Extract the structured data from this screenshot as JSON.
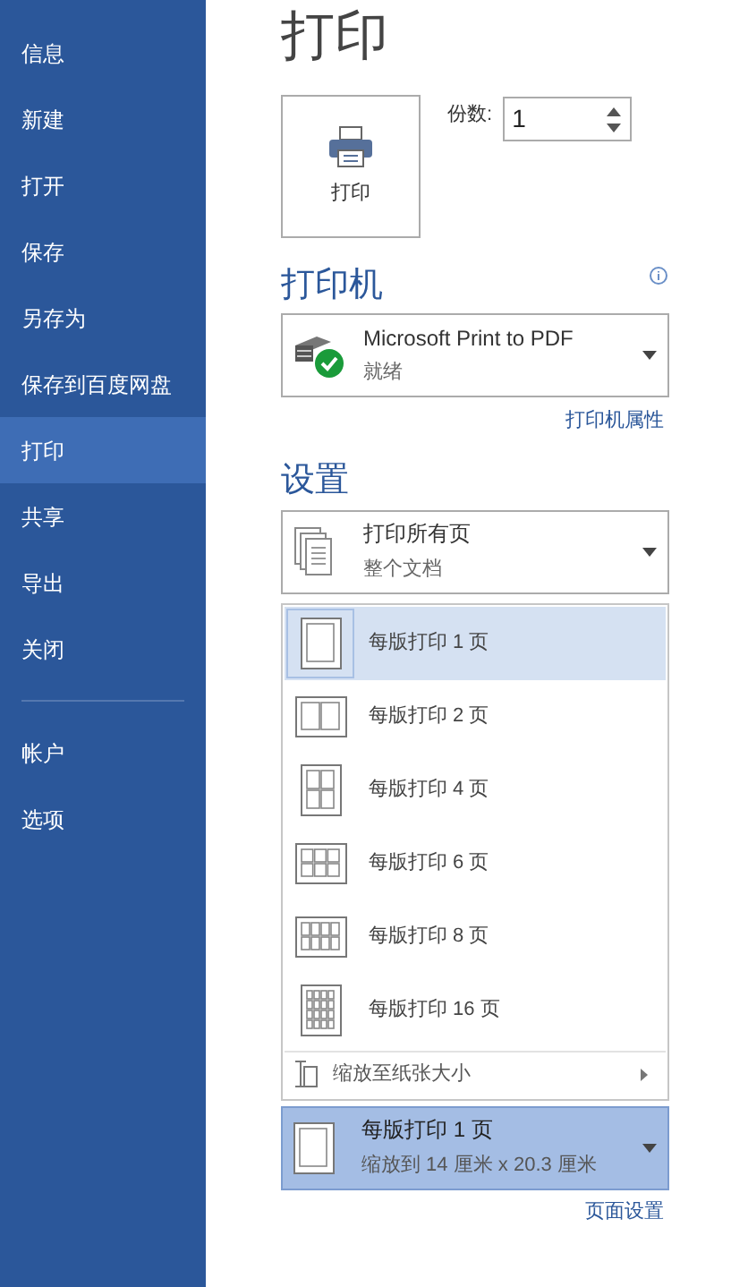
{
  "sidebar": {
    "items": [
      {
        "label": "信息",
        "selected": false
      },
      {
        "label": "新建",
        "selected": false
      },
      {
        "label": "打开",
        "selected": false
      },
      {
        "label": "保存",
        "selected": false
      },
      {
        "label": "另存为",
        "selected": false
      },
      {
        "label": "保存到百度网盘",
        "selected": false
      },
      {
        "label": "打印",
        "selected": true
      },
      {
        "label": "共享",
        "selected": false
      },
      {
        "label": "导出",
        "selected": false
      },
      {
        "label": "关闭",
        "selected": false
      }
    ],
    "footer_items": [
      {
        "label": "帐户",
        "selected": false
      },
      {
        "label": "选项",
        "selected": false
      }
    ]
  },
  "title": "打印",
  "print_button": {
    "label": "打印"
  },
  "copies": {
    "label": "份数:",
    "value": "1"
  },
  "printer": {
    "heading": "打印机",
    "name": "Microsoft Print to PDF",
    "status": "就绪",
    "properties_link": "打印机属性"
  },
  "settings": {
    "heading": "设置",
    "pages": {
      "title": "打印所有页",
      "subtitle": "整个文档"
    },
    "pages_per_sheet_menu": {
      "items": [
        {
          "kind": "one",
          "label": "每版打印 1 页",
          "selected": true
        },
        {
          "kind": "two",
          "label": "每版打印 2 页",
          "selected": false
        },
        {
          "kind": "four",
          "label": "每版打印 4 页",
          "selected": false
        },
        {
          "kind": "six",
          "label": "每版打印 6 页",
          "selected": false
        },
        {
          "kind": "eight",
          "label": "每版打印 8 页",
          "selected": false
        },
        {
          "kind": "sixteen",
          "label": "每版打印 16 页",
          "selected": false
        }
      ],
      "scale_item": {
        "label": "缩放至纸张大小"
      }
    },
    "pages_per_sheet": {
      "title": "每版打印 1 页",
      "subtitle": "缩放到 14 厘米 x 20.3 厘米"
    },
    "page_setup_link": "页面设置"
  }
}
